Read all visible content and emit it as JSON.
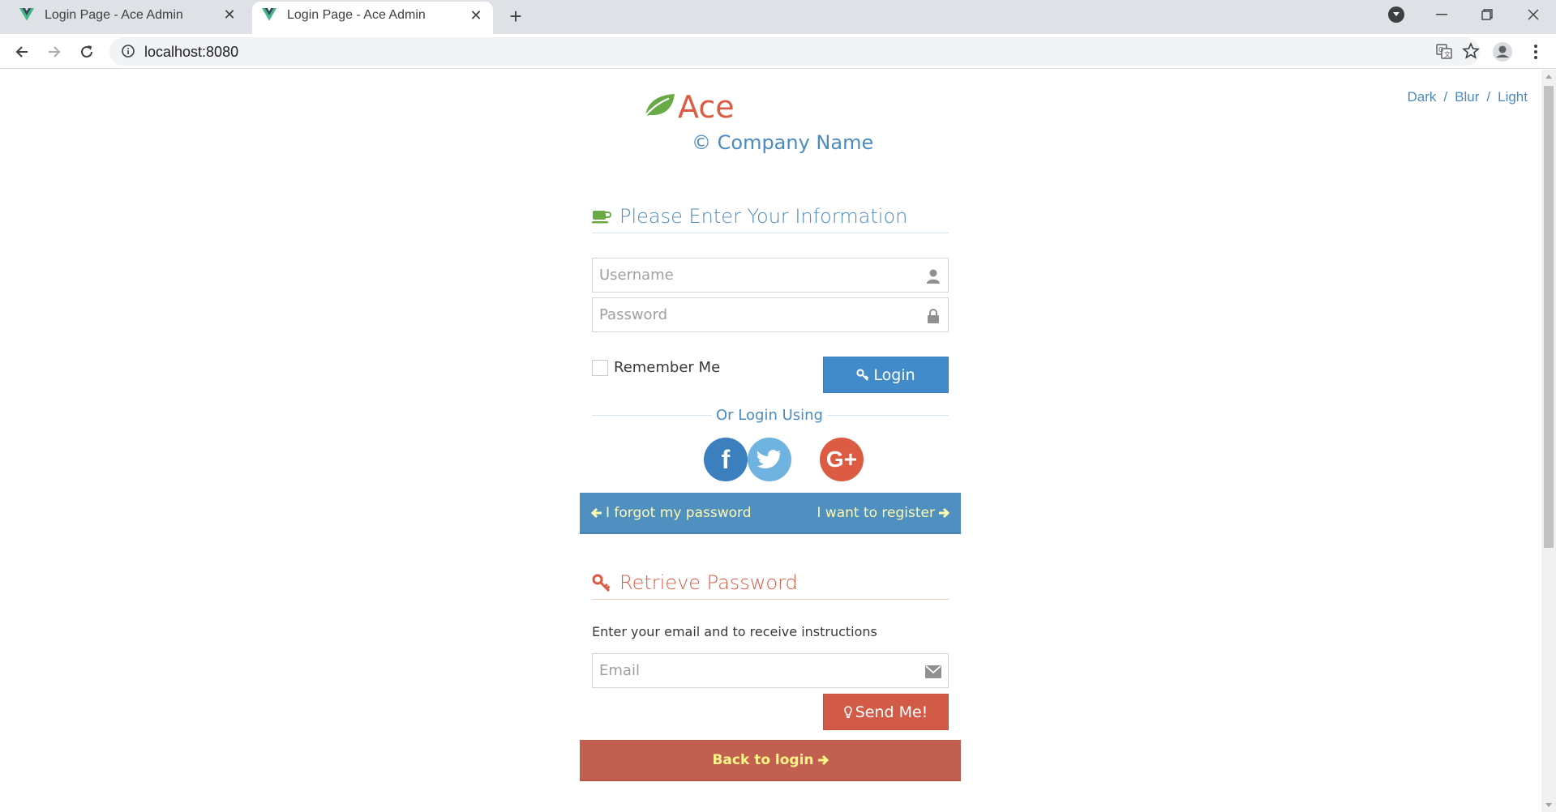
{
  "browser": {
    "tabs": [
      {
        "title": "Login Page - Ace Admin",
        "active": false
      },
      {
        "title": "Login Page - Ace Admin",
        "active": true
      }
    ],
    "url": "localhost:8080"
  },
  "page": {
    "theme_links": [
      "Dark",
      "Blur",
      "Light"
    ],
    "theme_sep": "/",
    "brand": {
      "name": "Ace",
      "company": "© Company Name"
    },
    "login": {
      "heading": "Please Enter Your Information",
      "username_placeholder": "Username",
      "password_placeholder": "Password",
      "remember_label": "Remember Me",
      "login_label": "Login",
      "or_login_using": "Or Login Using",
      "social": [
        "facebook",
        "twitter",
        "google-plus"
      ],
      "forgot_link": "I forgot my password",
      "register_link": "I want to register"
    },
    "retrieve": {
      "heading": "Retrieve Password",
      "instructions": "Enter your email and to receive instructions",
      "email_placeholder": "Email",
      "send_label": "Send Me!",
      "back_link": "Back to login"
    }
  },
  "colors": {
    "brand_red": "#dd5a43",
    "brand_blue": "#4a8bc2",
    "leaf_green": "#69aa46",
    "button_blue": "#428bca",
    "button_red": "#d15b47",
    "link_yellow": "#fef9b0"
  },
  "icons": {
    "tab_favicon": "vue-logo-icon",
    "heading_login": "coffee-icon",
    "heading_retrieve": "key-icon",
    "username": "user-icon",
    "password": "lock-icon",
    "email": "envelope-icon",
    "login_button": "key-icon",
    "send_button": "lightbulb-icon"
  }
}
